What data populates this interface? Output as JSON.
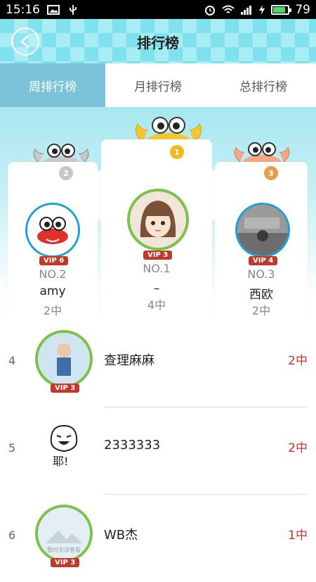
{
  "status_bar": {
    "time": "15:16",
    "battery": "79"
  },
  "header": {
    "title": "排行榜"
  },
  "tabs": [
    {
      "label": "周排行榜",
      "active": true
    },
    {
      "label": "月排行榜",
      "active": false
    },
    {
      "label": "总排行榜",
      "active": false
    }
  ],
  "podium": {
    "first": {
      "medal": "1",
      "vip": "VIP 3",
      "rank": "NO.1",
      "name": "–",
      "score": "4中"
    },
    "second": {
      "medal": "2",
      "vip": "VIP 6",
      "rank": "NO.2",
      "name": "amy",
      "score": "2中"
    },
    "third": {
      "medal": "3",
      "vip": "VIP 4",
      "rank": "NO.3",
      "name": "西欧",
      "score": "2中"
    }
  },
  "list": [
    {
      "num": "4",
      "name": "查理麻麻",
      "score": "2中",
      "vip": "VIP 3"
    },
    {
      "num": "5",
      "name": "2333333",
      "score": "2中",
      "avatar_text": "耶!"
    },
    {
      "num": "6",
      "name": "WB杰",
      "score": "1中",
      "vip": "VIP 3",
      "avatar_text": "暂时无法查看"
    }
  ],
  "colors": {
    "accent": "#7cc3da",
    "score_red": "#d0302b",
    "header_bg": "#7fe0ee"
  }
}
